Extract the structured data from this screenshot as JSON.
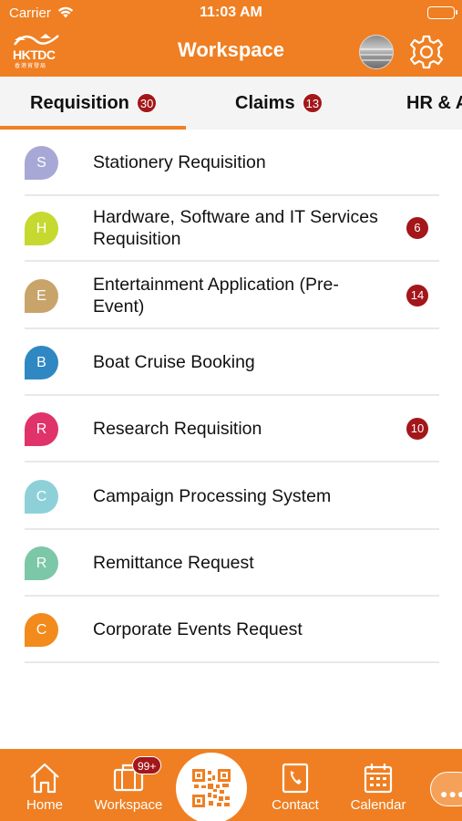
{
  "status_bar": {
    "carrier": "Carrier",
    "time": "11:03 AM"
  },
  "header": {
    "title": "Workspace",
    "logo_text": "HKTDC",
    "logo_subtext": "香港貿發局"
  },
  "tabs": [
    {
      "label": "Requisition",
      "count": "30",
      "selected": true
    },
    {
      "label": "Claims",
      "count": "13",
      "selected": false
    },
    {
      "label": "HR & A",
      "count": "",
      "selected": false
    }
  ],
  "requisition_items": [
    {
      "letter": "S",
      "label": "Stationery Requisition",
      "badge": "",
      "color": "#a8a8d6"
    },
    {
      "letter": "H",
      "label": "Hardware, Software and IT Services Requisition",
      "badge": "6",
      "color": "#c6d930"
    },
    {
      "letter": "E",
      "label": "Entertainment Application (Pre-Event)",
      "badge": "14",
      "color": "#c9a46a"
    },
    {
      "letter": "B",
      "label": "Boat Cruise Booking",
      "badge": "",
      "color": "#2f88c2"
    },
    {
      "letter": "R",
      "label": "Research Requisition",
      "badge": "10",
      "color": "#e0336a"
    },
    {
      "letter": "C",
      "label": "Campaign Processing System",
      "badge": "",
      "color": "#8ed0d8"
    },
    {
      "letter": "R",
      "label": "Remittance Request",
      "badge": "",
      "color": "#7cc7a8"
    },
    {
      "letter": "C",
      "label": "Corporate Events Request",
      "badge": "",
      "color": "#f28a1c"
    }
  ],
  "bottom_tabs": {
    "home": "Home",
    "workspace": "Workspace",
    "workspace_badge": "99+",
    "contact": "Contact",
    "calendar": "Calendar"
  },
  "colors": {
    "brand": "#ef7f22",
    "badge": "#a3161a",
    "tab_background": "#f4f4f4"
  },
  "icons": [
    "wifi-icon",
    "battery-icon",
    "hktdc-logo",
    "avatar",
    "gear-icon",
    "home-icon",
    "briefcase-icon",
    "qr-code-icon",
    "contact-phone-icon",
    "calendar-icon",
    "more-icon"
  ]
}
